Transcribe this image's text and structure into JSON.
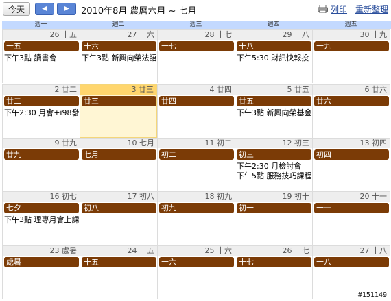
{
  "toolbar": {
    "today_label": "今天",
    "prev_glyph": "◀",
    "next_glyph": "▶",
    "period_title": "2010年8月 農曆六月 ~ 七月",
    "print_label": "列印",
    "refresh_label": "重新整理"
  },
  "weekdays": [
    "週一",
    "週二",
    "週三",
    "週四",
    "週五"
  ],
  "weeks": [
    {
      "days": [
        {
          "num": "26 十五",
          "chip": "十五",
          "events": [
            "下午3點 讀書會"
          ]
        },
        {
          "num": "27 十六",
          "chip": "十六",
          "events": [
            "下午3點 新興向榮法語"
          ]
        },
        {
          "num": "28 十七",
          "chip": "十七",
          "events": []
        },
        {
          "num": "29 十八",
          "chip": "十八",
          "events": [
            "下午5:30 財訊快報投"
          ]
        },
        {
          "num": "30 十九",
          "chip": "十九",
          "events": []
        }
      ]
    },
    {
      "days": [
        {
          "num": "2 廿二",
          "chip": "廿二",
          "events": [
            "下午2:30 月會+i98發"
          ]
        },
        {
          "num": "3 廿三",
          "chip": "廿三",
          "events": [],
          "today": true
        },
        {
          "num": "4 廿四",
          "chip": "廿四",
          "events": []
        },
        {
          "num": "5 廿五",
          "chip": "廿五",
          "events": [
            "下午3點 新興向榮基金"
          ]
        },
        {
          "num": "6 廿六",
          "chip": "廿六",
          "events": []
        }
      ]
    },
    {
      "days": [
        {
          "num": "9 廿九",
          "chip": "廿九",
          "events": []
        },
        {
          "num": "10 七月",
          "chip": "七月",
          "events": []
        },
        {
          "num": "11 初二",
          "chip": "初二",
          "events": []
        },
        {
          "num": "12 初三",
          "chip": "初三",
          "events": [
            "下午2:30 月檢討會",
            "下午5點 服務技巧課程"
          ]
        },
        {
          "num": "13 初四",
          "chip": "初四",
          "events": []
        }
      ]
    },
    {
      "days": [
        {
          "num": "16 初七",
          "chip": "七夕",
          "events": [
            "下午3點 理專月會上課"
          ]
        },
        {
          "num": "17 初八",
          "chip": "初八",
          "events": []
        },
        {
          "num": "18 初九",
          "chip": "初九",
          "events": []
        },
        {
          "num": "19 初十",
          "chip": "初十",
          "events": []
        },
        {
          "num": "20 十一",
          "chip": "十一",
          "events": []
        }
      ]
    },
    {
      "days": [
        {
          "num": "23 處暑",
          "chip": "處暑",
          "events": []
        },
        {
          "num": "24 十五",
          "chip": "十五",
          "events": []
        },
        {
          "num": "25 十六",
          "chip": "十六",
          "events": []
        },
        {
          "num": "26 十七",
          "chip": "十七",
          "events": []
        },
        {
          "num": "27 十八",
          "chip": "十八",
          "events": []
        }
      ]
    }
  ],
  "colors": {
    "chip": "#7b3b06",
    "today": "#fff6d4",
    "header": "#c3d9ff",
    "link": "#2a4e9c"
  },
  "watermark": "#151149"
}
